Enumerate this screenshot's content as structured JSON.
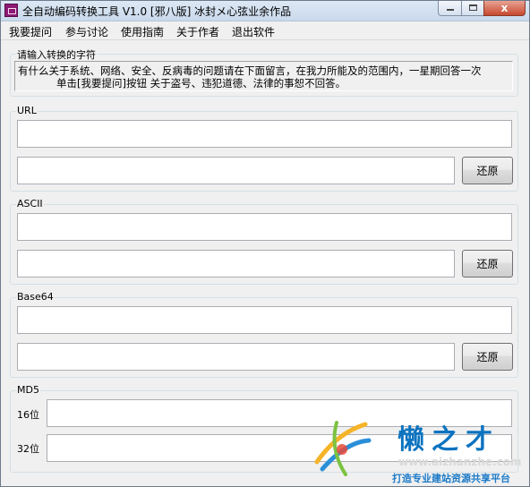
{
  "window": {
    "title": "全自动编码转换工具 V1.0 [邪八版] 冰封メ心弦业余作品",
    "close_glyph": "x"
  },
  "menu": [
    "我要提问",
    "参与讨论",
    "使用指南",
    "关于作者",
    "退出软件"
  ],
  "input_group": {
    "label": "请输入转换的字符",
    "line1": "有什么关于系统、网络、安全、反病毒的问题请在下面留言，在我力所能及的范围内，一星期回答一次",
    "line2": "单击[我要提问]按钮 关于盗号、违犯道德、法律的事恕不回答。"
  },
  "url": {
    "label": "URL",
    "encoded": "",
    "decoded": "",
    "button": "还原"
  },
  "ascii": {
    "label": "ASCII",
    "encoded": "",
    "decoded": "",
    "button": "还原"
  },
  "base64": {
    "label": "Base64",
    "encoded": "",
    "decoded": "",
    "button": "还原"
  },
  "md5": {
    "label": "MD5",
    "label16": "16位",
    "label32": "32位",
    "value16": "",
    "value32": ""
  },
  "watermark": {
    "brand": "懒之才",
    "url": "www.aizhanzhe.com",
    "slogan": "打造专业建站资源共享平台"
  },
  "colors": {
    "titlebar": "#c9d9ec",
    "close_button": "#c6482f",
    "watermark_blue": "#0c73c0"
  }
}
